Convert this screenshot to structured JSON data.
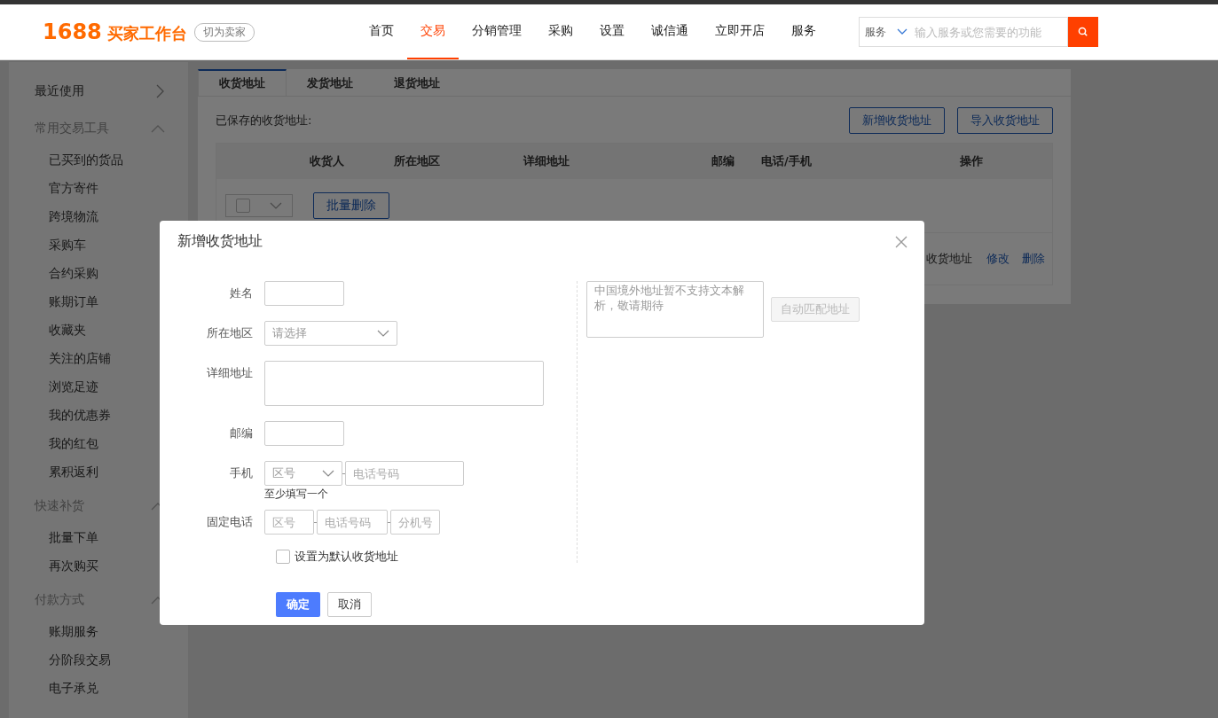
{
  "header": {
    "logo_number": "1688",
    "logo_text": "买家工作台",
    "switch_button": "切为卖家",
    "nav": [
      {
        "label": "首页",
        "selected": false
      },
      {
        "label": "交易",
        "selected": true
      },
      {
        "label": "分销管理",
        "selected": false
      },
      {
        "label": "采购",
        "selected": false
      },
      {
        "label": "设置",
        "selected": false
      },
      {
        "label": "诚信通",
        "selected": false
      },
      {
        "label": "立即开店",
        "selected": false
      },
      {
        "label": "服务",
        "selected": false
      }
    ],
    "search": {
      "scope": "服务",
      "placeholder": "输入服务或您需要的功能"
    }
  },
  "sidebar": [
    {
      "title": "最近使用",
      "kind": "link"
    },
    {
      "title": "常用交易工具",
      "kind": "group",
      "items": [
        "已买到的货品",
        "官方寄件",
        "跨境物流",
        "采购车",
        "合约采购",
        "账期订单",
        "收藏夹",
        "关注的店铺",
        "浏览足迹",
        "我的优惠券",
        "我的红包",
        "累积返利"
      ]
    },
    {
      "title": "快速补货",
      "kind": "group",
      "items": [
        "批量下单",
        "再次购买"
      ]
    },
    {
      "title": "付款方式",
      "kind": "group",
      "items": [
        "账期服务",
        "分阶段交易",
        "电子承兑"
      ]
    }
  ],
  "tabs": [
    {
      "label": "收货地址",
      "selected": true
    },
    {
      "label": "发货地址",
      "selected": false
    },
    {
      "label": "退货地址",
      "selected": false
    }
  ],
  "saved_label": "已保存的收货地址:",
  "actions": [
    "新增收货地址",
    "导入收货地址"
  ],
  "table": {
    "columns": [
      "收货人",
      "所在地区",
      "详细地址",
      "邮编",
      "电话/手机",
      "操作"
    ],
    "batch_delete": "批量删除",
    "select_all_checked": false,
    "rows": [
      {
        "cells": [
          "收货地址"
        ],
        "actions": [
          "修改",
          "删除"
        ]
      }
    ]
  },
  "dialog": {
    "title": "新增收货地址",
    "fields": [
      {
        "label": "姓名",
        "parts": [
          {
            "kind": "input"
          }
        ]
      },
      {
        "label": "所在地区",
        "parts": [
          {
            "kind": "select",
            "placeholder": "请选择"
          }
        ]
      },
      {
        "label": "详细地址",
        "parts": [
          {
            "kind": "textarea"
          }
        ]
      },
      {
        "label": "邮编",
        "parts": [
          {
            "kind": "input"
          }
        ]
      },
      {
        "label": "手机",
        "parts": [
          {
            "kind": "select",
            "placeholder": "区号"
          },
          {
            "kind": "input",
            "placeholder": "电话号码"
          }
        ],
        "hint": "至少填写一个"
      },
      {
        "label": "固定电话",
        "parts": [
          {
            "kind": "input",
            "placeholder": "区号"
          },
          {
            "kind": "input",
            "placeholder": "电话号码"
          },
          {
            "kind": "input",
            "placeholder": "分机号"
          }
        ]
      }
    ],
    "default_checkbox": {
      "label": "设置为默认收货地址",
      "checked": false
    },
    "parse_box": {
      "placeholder": "中国境外地址暂不支持文本解析，敬请期待"
    },
    "auto_match_button": {
      "label": "自动匹配地址",
      "disabled": true
    },
    "confirm_button": "确定",
    "cancel_button": "取消"
  }
}
